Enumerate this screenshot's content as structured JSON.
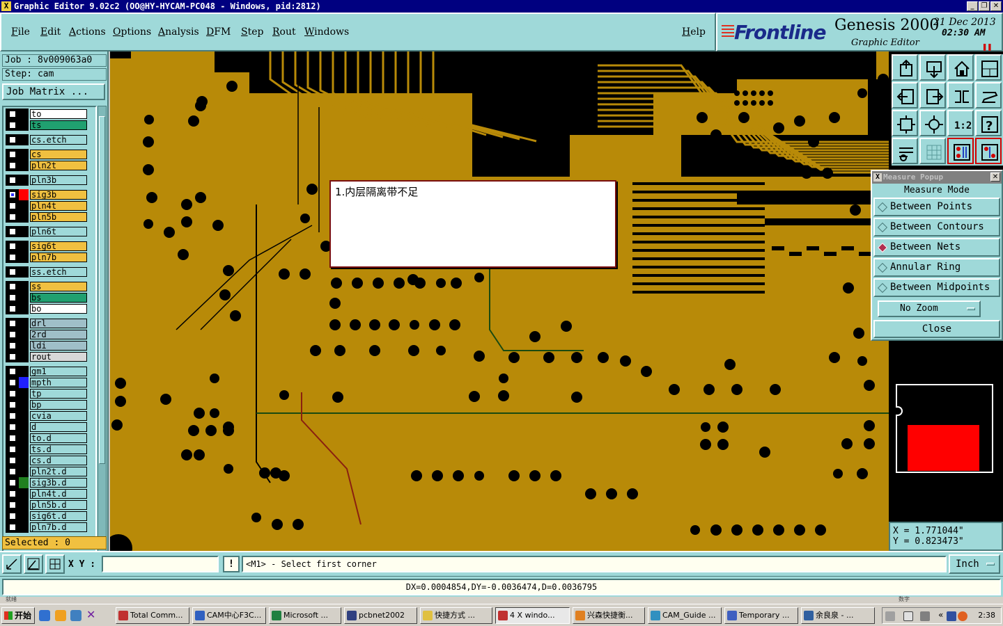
{
  "window": {
    "title": "Graphic Editor 9.02c2 (OO@HY-HYCAM-PC048 - Windows, pid:2812)"
  },
  "menu": [
    "File",
    "Edit",
    "Actions",
    "Options",
    "Analysis",
    "DFM",
    "Step",
    "Rout",
    "Windows"
  ],
  "help_label": "Help",
  "brand": {
    "logo": "Frontline",
    "product": "Genesis 2000",
    "subtitle": "Graphic Editor",
    "date": "21 Dec 2013",
    "time": "02:30 AM"
  },
  "job": {
    "job_line": "Job : 8v009063a0",
    "step_line": "Step: cam",
    "matrix_button": "Job Matrix ..."
  },
  "layers": [
    {
      "name": "to",
      "color": "#ffffff",
      "group": 0
    },
    {
      "name": "ts",
      "color": "#20a070",
      "group": 0
    },
    {
      "name": "cs.etch",
      "color": "#9fd9d9",
      "group": 1
    },
    {
      "name": "cs",
      "color": "#f0c040",
      "group": 2
    },
    {
      "name": "pln2t",
      "color": "#f0c040",
      "group": 2
    },
    {
      "name": "pln3b",
      "color": "#9fd9d9",
      "group": 3
    },
    {
      "name": "sig3b",
      "color": "#f0c040",
      "group": 4,
      "active": true
    },
    {
      "name": "pln4t",
      "color": "#f0c040",
      "group": 4
    },
    {
      "name": "pln5b",
      "color": "#f0c040",
      "group": 4
    },
    {
      "name": "pln6t",
      "color": "#9fd9d9",
      "group": 5
    },
    {
      "name": "sig6t",
      "color": "#f0c040",
      "group": 6
    },
    {
      "name": "pln7b",
      "color": "#f0c040",
      "group": 6
    },
    {
      "name": "ss.etch",
      "color": "#9fd9d9",
      "group": 7
    },
    {
      "name": "ss",
      "color": "#f0c040",
      "group": 8
    },
    {
      "name": "bs",
      "color": "#20a070",
      "group": 8
    },
    {
      "name": "bo",
      "color": "#ffffff",
      "group": 8
    },
    {
      "name": "drl",
      "color": "#9fbfc8",
      "group": 9
    },
    {
      "name": "2rd",
      "color": "#9fbfc8",
      "group": 9
    },
    {
      "name": "ldi",
      "color": "#9fbfc8",
      "group": 9
    },
    {
      "name": "rout",
      "color": "#d8d8d8",
      "group": 9
    },
    {
      "name": "gm1",
      "color": "#9fd9d9",
      "group": 10
    },
    {
      "name": "mpth",
      "color": "#9fd9d9",
      "group": 10,
      "swatch": "#2020ff"
    },
    {
      "name": "tp",
      "color": "#9fd9d9",
      "group": 10
    },
    {
      "name": "bp",
      "color": "#9fd9d9",
      "group": 10
    },
    {
      "name": "cvia",
      "color": "#9fd9d9",
      "group": 10
    },
    {
      "name": "d",
      "color": "#9fd9d9",
      "group": 10
    },
    {
      "name": "to.d",
      "color": "#9fd9d9",
      "group": 10
    },
    {
      "name": "ts.d",
      "color": "#9fd9d9",
      "group": 10
    },
    {
      "name": "cs.d",
      "color": "#9fd9d9",
      "group": 10
    },
    {
      "name": "pln2t.d",
      "color": "#9fd9d9",
      "group": 10
    },
    {
      "name": "sig3b.d",
      "color": "#9fd9d9",
      "group": 10,
      "swatch": "#208020"
    },
    {
      "name": "pln4t.d",
      "color": "#9fd9d9",
      "group": 10
    },
    {
      "name": "pln5b.d",
      "color": "#9fd9d9",
      "group": 10
    },
    {
      "name": "sig6t.d",
      "color": "#9fd9d9",
      "group": 10
    },
    {
      "name": "pln7b.d",
      "color": "#9fd9d9",
      "group": 10
    }
  ],
  "selected_label": "Selected : 0",
  "annotation": {
    "text": "1.内层隔离带不足"
  },
  "canvas": {
    "copper_color": "#b88a08",
    "background_color": "#000000"
  },
  "measure": {
    "title": "Measure Popup",
    "mode_header": "Measure Mode",
    "options": [
      {
        "label": "Between Points",
        "selected": false
      },
      {
        "label": "Between Contours",
        "selected": false
      },
      {
        "label": "Between Nets",
        "selected": true
      },
      {
        "label": "Annular Ring",
        "selected": false
      },
      {
        "label": "Between Midpoints",
        "selected": false
      }
    ],
    "zoom_label": "No Zoom",
    "close_label": "Close"
  },
  "tools": [
    "home-icon",
    "pan-down-icon",
    "house-icon",
    "zoom-window-icon",
    "pan-left-icon",
    "pan-right-icon",
    "flip-icon",
    "snap-icon",
    "zoom-fit-icon",
    "center-icon",
    "scale-icon",
    "help-icon",
    "settings-icon",
    "grid-icon",
    "layer-select-icon",
    "layer-red-icon"
  ],
  "coordinates": {
    "x": "X = 1.771044\"",
    "y": "Y = 0.823473\""
  },
  "bottom": {
    "xy_label": "X Y :",
    "xy_value": "",
    "prompt": "<M1> - Select first corner",
    "unit": "Inch",
    "measurement": "DX=0.0004854,DY=-0.0036474,D=0.0036795"
  },
  "strip": {
    "left": "就绪",
    "right": "数字"
  },
  "taskbar": {
    "start": "开始",
    "tasks": [
      {
        "label": "Total Comm...",
        "color": "#c03030"
      },
      {
        "label": "CAM中心F3C...",
        "color": "#3060c0"
      },
      {
        "label": "Microsoft ...",
        "color": "#208040"
      },
      {
        "label": "pcbnet2002",
        "color": "#304080"
      },
      {
        "label": "快捷方式 ...",
        "color": "#e0c040"
      },
      {
        "label": "4 X windo...",
        "color": "#c03030",
        "active": true
      },
      {
        "label": "兴森快捷衡...",
        "color": "#e08020"
      },
      {
        "label": "CAM_Guide ...",
        "color": "#3090c0"
      },
      {
        "label": "Temporary ...",
        "color": "#4060c0"
      },
      {
        "label": "余良泉 - ...",
        "color": "#3060a0"
      }
    ],
    "clock": "2:38"
  }
}
